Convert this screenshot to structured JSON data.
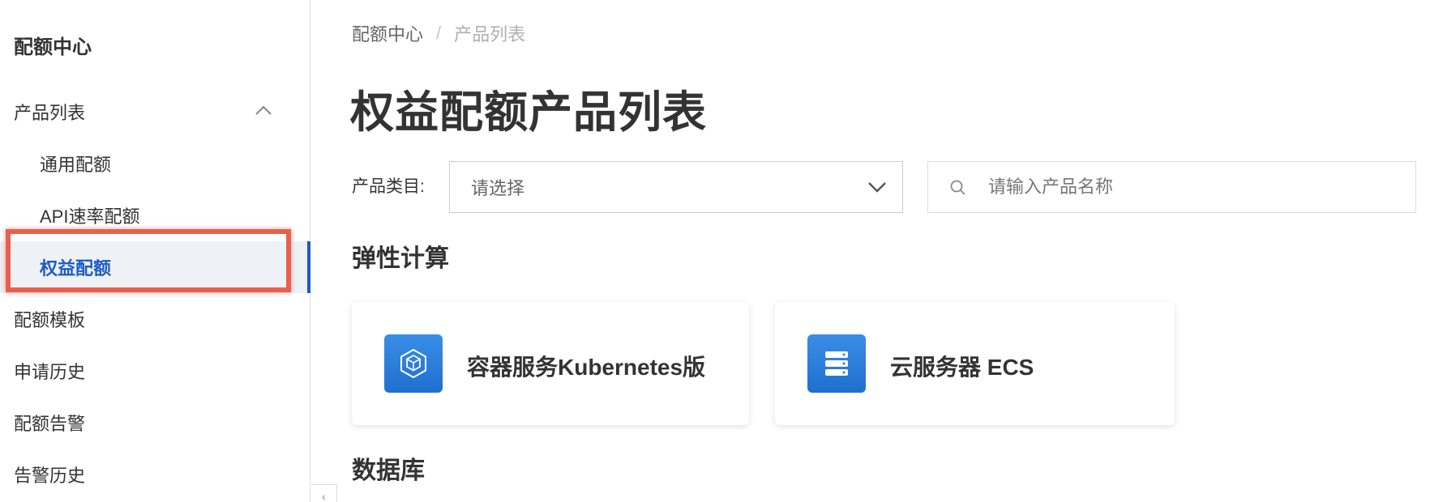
{
  "sidebar": {
    "title": "配额中心",
    "items": [
      {
        "label": "产品列表"
      },
      {
        "label": "通用配额"
      },
      {
        "label": "API速率配额"
      },
      {
        "label": "权益配额"
      },
      {
        "label": "配额模板"
      },
      {
        "label": "申请历史"
      },
      {
        "label": "配额告警"
      },
      {
        "label": "告警历史"
      }
    ]
  },
  "breadcrumb": {
    "root": "配额中心",
    "separator": "/",
    "current": "产品列表"
  },
  "page_title": "权益配额产品列表",
  "filters": {
    "category_label": "产品类目:",
    "category_value": "请选择",
    "search_placeholder": "请输入产品名称"
  },
  "sections": [
    {
      "title": "弹性计算",
      "products": [
        {
          "name": "容器服务Kubernetes版",
          "icon": "container-cube-icon"
        },
        {
          "name": "云服务器 ECS",
          "icon": "server-stack-icon"
        }
      ]
    },
    {
      "title": "数据库",
      "products": []
    }
  ],
  "colors": {
    "accent": "#1e5bc6",
    "highlight": "#e8604d",
    "icon_bg": "#2a7fdb"
  }
}
